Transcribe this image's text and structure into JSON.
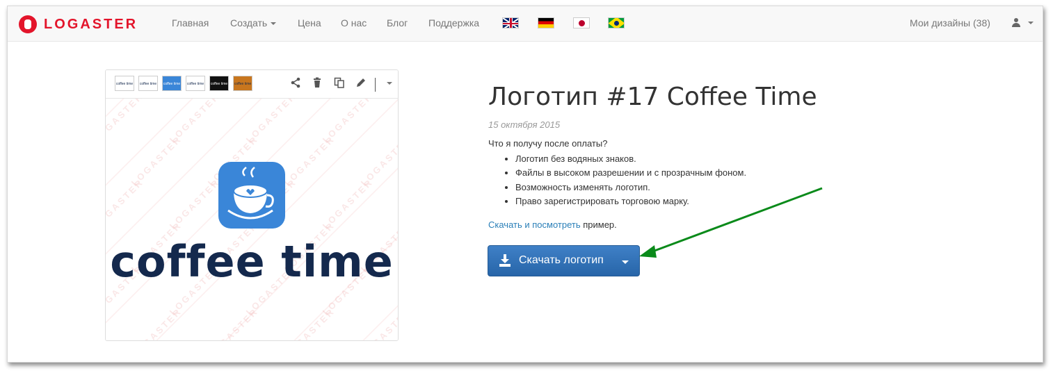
{
  "navbar": {
    "brand": "LOGASTER",
    "items": [
      {
        "label": "Главная"
      },
      {
        "label": "Создать"
      },
      {
        "label": "Цена"
      },
      {
        "label": "О нас"
      },
      {
        "label": "Блог"
      },
      {
        "label": "Поддержка"
      }
    ],
    "flags": [
      "uk-flag-icon",
      "germany-flag-icon",
      "japan-flag-icon",
      "brazil-flag-icon"
    ],
    "my_designs": "Мои дизайны (38)",
    "user_icon": "user-icon"
  },
  "preview": {
    "thumbnails": [
      {
        "label": "coffee time",
        "bg": "#ffffff",
        "fg": "#14294d"
      },
      {
        "label": "coffee time",
        "bg": "#ffffff",
        "fg": "#14294d"
      },
      {
        "label": "coffee time",
        "bg": "#3a86d8",
        "fg": "#ffffff"
      },
      {
        "label": "coffee time",
        "bg": "#ffffff",
        "fg": "#14294d"
      },
      {
        "label": "coffee time",
        "bg": "#111111",
        "fg": "#ffffff"
      },
      {
        "label": "coffee time",
        "bg": "#c8761e",
        "fg": "#14294d"
      }
    ],
    "tools": [
      "share-icon",
      "trash-icon",
      "copy-icon",
      "pencil-icon",
      "caret-down-icon"
    ],
    "watermark": "LOGASTER",
    "logo_text": "coffee time",
    "colors": {
      "badge": "#3a86d8",
      "text": "#14294d"
    }
  },
  "details": {
    "title": "Логотип #17 Coffee Time",
    "date": "15 октября 2015",
    "question": "Что я получу после оплаты?",
    "features": [
      "Логотип без водяных знаков.",
      "Файлы в высоком разрешении и с прозрачным фоном.",
      "Возможность изменять логотип.",
      "Право зарегистрировать торговою марку."
    ],
    "sample_link": "Скачать и посмотреть",
    "sample_suffix": " пример.",
    "download_button": "Скачать логотип",
    "annotation_arrow_color": "#0a8a1a"
  }
}
